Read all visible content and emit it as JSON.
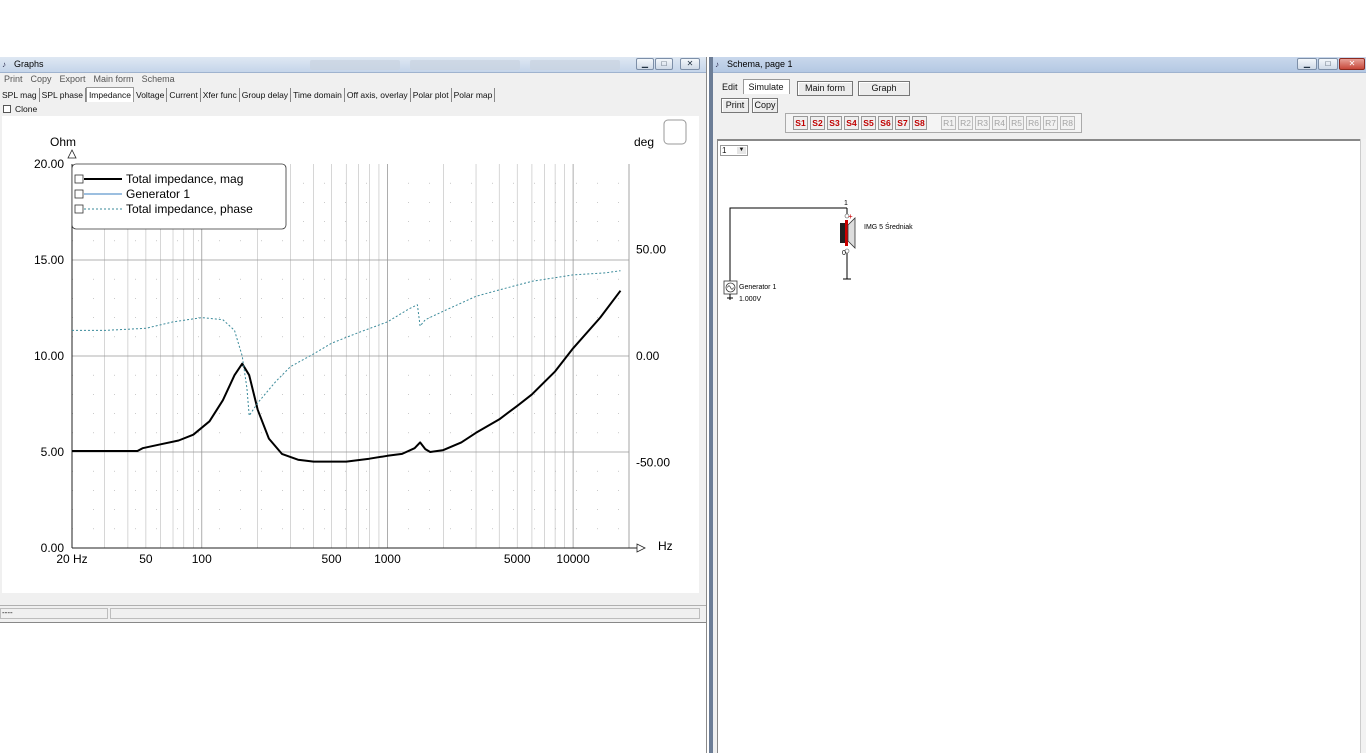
{
  "graphs_window": {
    "title": "Graphs",
    "menu": [
      "Print",
      "Copy",
      "Export",
      "Main form",
      "Schema"
    ],
    "tabs": [
      "SPL mag",
      "SPL phase",
      "Impedance",
      "Voltage",
      "Current",
      "Xfer func",
      "Group delay",
      "Time domain",
      "Off axis, overlay",
      "Polar plot",
      "Polar map"
    ],
    "active_tab": "Impedance",
    "clone_label": "Clone",
    "status_text": "----"
  },
  "chart_data": {
    "type": "line",
    "x_scale": "log",
    "x_range": [
      20,
      20000
    ],
    "y_left": {
      "unit": "Ohm",
      "range": [
        0,
        20
      ],
      "ticks": [
        "0.00",
        "5.00",
        "10.00",
        "15.00",
        "20.00"
      ]
    },
    "y_right": {
      "unit": "deg",
      "range": [
        -90,
        90
      ],
      "ticks": [
        "-50.00",
        "0.00",
        "50.00"
      ]
    },
    "x_unit": "Hz",
    "x_ticks": [
      {
        "value": 20,
        "label": "20 Hz"
      },
      {
        "value": 50,
        "label": "50"
      },
      {
        "value": 100,
        "label": "100"
      },
      {
        "value": 500,
        "label": "500"
      },
      {
        "value": 1000,
        "label": "1000"
      },
      {
        "value": 5000,
        "label": "5000"
      },
      {
        "value": 10000,
        "label": "10000"
      }
    ],
    "grid": true,
    "legend_position": "top-left",
    "series": [
      {
        "name": "Total impedance, mag",
        "axis": "left",
        "style": "solid-bold",
        "color": "#000000",
        "x": [
          20,
          30,
          45,
          48,
          60,
          75,
          90,
          110,
          130,
          150,
          165,
          180,
          200,
          230,
          270,
          330,
          400,
          500,
          600,
          800,
          1000,
          1200,
          1400,
          1500,
          1600,
          1700,
          2000,
          2500,
          3000,
          4000,
          5000,
          6000,
          8000,
          10000,
          14000,
          18000
        ],
        "values": [
          5.05,
          5.05,
          5.05,
          5.2,
          5.4,
          5.6,
          5.9,
          6.6,
          7.7,
          9.0,
          9.6,
          9.0,
          7.2,
          5.7,
          4.9,
          4.6,
          4.5,
          4.5,
          4.5,
          4.65,
          4.8,
          4.9,
          5.2,
          5.5,
          5.15,
          5.0,
          5.1,
          5.5,
          6.0,
          6.7,
          7.4,
          8.0,
          9.2,
          10.4,
          12.0,
          13.4
        ]
      },
      {
        "name": "Generator 1",
        "axis": "left",
        "style": "solid-thin",
        "color": "#3a7fc0",
        "x": [],
        "values": []
      },
      {
        "name": "Total impedance, phase",
        "axis": "right",
        "style": "dotted",
        "color": "#3a8a9a",
        "x": [
          20,
          30,
          50,
          70,
          100,
          130,
          150,
          165,
          175,
          180,
          200,
          250,
          300,
          400,
          500,
          700,
          1000,
          1300,
          1450,
          1500,
          1600,
          2000,
          3000,
          4000,
          6000,
          10000,
          15000,
          18000
        ],
        "values": [
          12,
          12,
          13,
          16,
          18,
          17,
          12,
          0,
          -15,
          -28,
          -22,
          -12,
          -5,
          1,
          6,
          11,
          16,
          22,
          24,
          14,
          17,
          21,
          28,
          31,
          35,
          38,
          39,
          40
        ]
      }
    ]
  },
  "schema_window": {
    "title": "Schema, page 1",
    "menu": [
      "Edit",
      "Simulate"
    ],
    "active_menu": "Simulate",
    "buttons": {
      "main_form": "Main form",
      "graph": "Graph",
      "print": "Print",
      "copy": "Copy"
    },
    "s_buttons": [
      "S1",
      "S2",
      "S3",
      "S4",
      "S5",
      "S6",
      "S7",
      "S8"
    ],
    "r_buttons": [
      "R1",
      "R2",
      "R3",
      "R4",
      "R5",
      "R6",
      "R7",
      "R8"
    ],
    "page_select": "1",
    "components": {
      "speaker": {
        "label": "IMG 5 Średniak",
        "node_top": "1",
        "node_bottom": "0",
        "plus": "+"
      },
      "generator": {
        "label": "Generator 1",
        "value": "1.000V"
      }
    }
  }
}
